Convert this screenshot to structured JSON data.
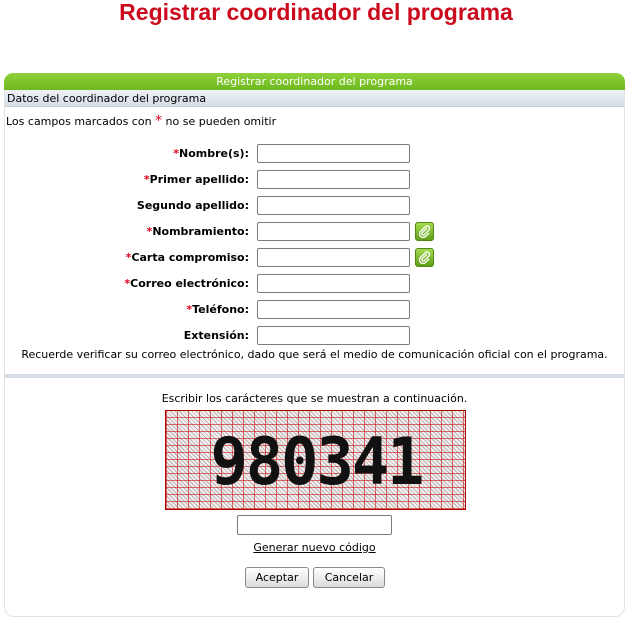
{
  "page": {
    "title": "Registrar coordinador del programa"
  },
  "panel": {
    "header": "Registrar coordinador del programa",
    "section": "Datos del coordinador del programa",
    "required_note_before": "Los campos marcados con ",
    "required_star": "*",
    "required_note_after": " no se pueden omitir"
  },
  "fields": [
    {
      "label": "Nombre(s):",
      "required": true,
      "value": ""
    },
    {
      "label": "Primer apellido:",
      "required": true,
      "value": ""
    },
    {
      "label": "Segundo apellido:",
      "required": false,
      "value": ""
    },
    {
      "label": "Nombramiento:",
      "required": true,
      "value": "",
      "icon": "paperclip-icon"
    },
    {
      "label": "Carta compromiso:",
      "required": true,
      "value": "",
      "icon": "paperclip-icon"
    },
    {
      "label": "Correo electrónico:",
      "required": true,
      "value": ""
    },
    {
      "label": "Teléfono:",
      "required": true,
      "value": ""
    },
    {
      "label": "Extensión:",
      "required": false,
      "value": ""
    }
  ],
  "verify_note": "Recuerde verificar su correo electrónico, dado que será el medio de comunicación oficial con el programa.",
  "captcha": {
    "instruction": "Escribir los carácteres que se muestran a continuación.",
    "image_text": "980341",
    "input_value": "",
    "regenerate_label": "Generar nuevo código"
  },
  "buttons": {
    "accept": "Aceptar",
    "cancel": "Cancelar"
  },
  "colors": {
    "title": "#cc0a1e",
    "header_green": "#7cc42a",
    "required_red": "#e0001b"
  }
}
